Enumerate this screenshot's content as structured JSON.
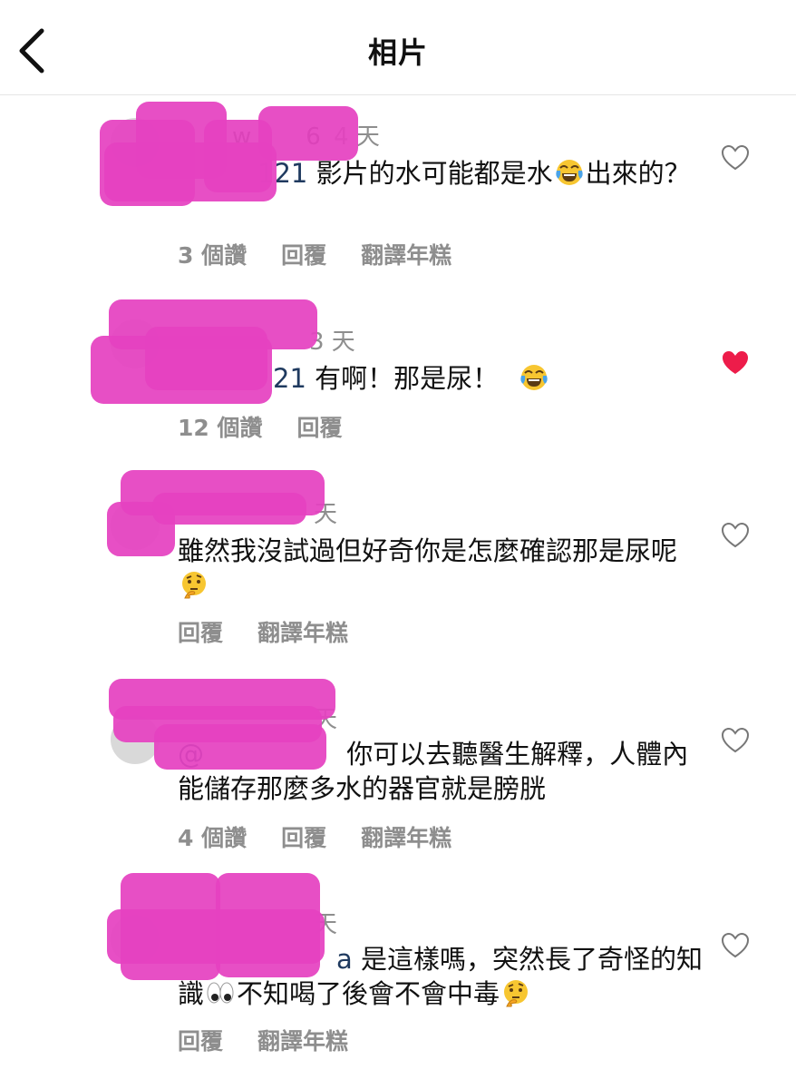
{
  "header": {
    "title": "相片",
    "back_icon": "chevron-left-icon"
  },
  "colors": {
    "like_active": "#ed1c4a",
    "redaction": "#e542c1",
    "muted": "#8e8e8e"
  },
  "comments": [
    {
      "username_partial": "w",
      "username_tail": "6",
      "time": "4 天",
      "mention_partial": "121",
      "text": "影片的水可能都是水",
      "emoji": "face-with-tears-of-joy",
      "text_after": "出來的？",
      "likes": "3 個讚",
      "reply": "回覆",
      "translate": "翻譯年糕",
      "liked": false
    },
    {
      "time": "3 天",
      "mention_partial": "21",
      "text": "有啊！那是尿！",
      "emoji": "face-with-tears-of-joy",
      "likes": "12 個讚",
      "reply": "回覆",
      "liked": true
    },
    {
      "time": "天",
      "text": "雖然我沒試過但好奇你是怎麼確認那是尿呢",
      "emoji": "thinking-face",
      "reply": "回覆",
      "translate": "翻譯年糕",
      "liked": false
    },
    {
      "time": "天",
      "mention_partial": "@",
      "text": "你可以去聽醫生解釋，人體內能儲存那麼多水的器官就是膀胱",
      "likes": "4 個讚",
      "reply": "回覆",
      "translate": "翻譯年糕",
      "liked": false
    },
    {
      "time": "天",
      "mention_partial": "a",
      "text": "是這樣嗎，突然長了奇怪的知識",
      "emoji": "eyes",
      "text_after": "不知喝了後會不會中毒",
      "emoji_after": "thinking-face",
      "reply": "回覆",
      "translate": "翻譯年糕",
      "liked": false
    }
  ]
}
